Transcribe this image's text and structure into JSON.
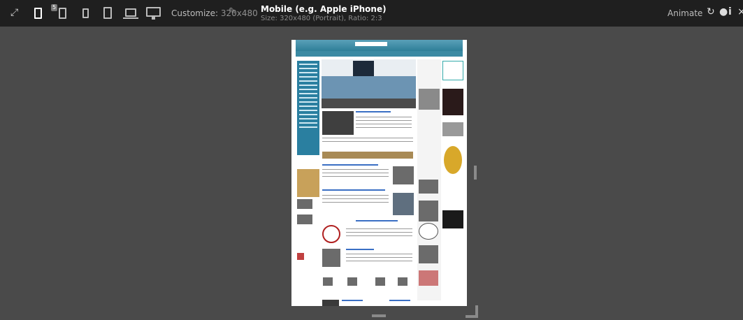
{
  "toolbar": {
    "device_badge": "5",
    "customize_label": "Customize:",
    "customize_value": "320x480",
    "device_title": "Mobile (e.g. Apple iPhone)",
    "device_subtitle": "Size: 320x480 (Portrait), Ratio: 2:3",
    "animate_label": "Animate",
    "icons": [
      "expand-icon",
      "phone-icon",
      "phone-small-icon",
      "tablet-icon",
      "tablet-large-icon",
      "laptop-icon",
      "desktop-icon",
      "pencil-icon",
      "rotate-icon",
      "drop-icon",
      "info-icon",
      "close-icon"
    ]
  },
  "colors": {
    "toolbar_bg": "#1f1f1f",
    "canvas_bg": "#4a4a4a",
    "site_accent": "#2e7f98"
  }
}
